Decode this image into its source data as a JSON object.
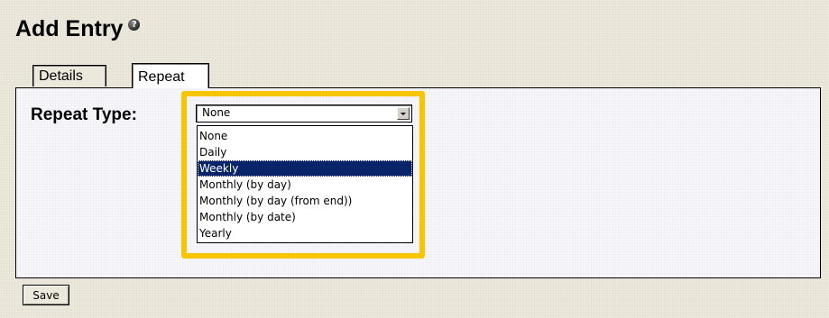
{
  "page": {
    "title": "Add Entry",
    "help_icon": "help-icon",
    "help_icon_glyph": "?"
  },
  "tabs": [
    {
      "label": "Details",
      "active": false
    },
    {
      "label": "Repeat",
      "active": true
    }
  ],
  "repeat": {
    "label": "Repeat Type:",
    "selected_value": "None",
    "options": [
      "None",
      "Daily",
      "Weekly",
      "Monthly (by day)",
      "Monthly (by day (from end))",
      "Monthly (by date)",
      "Yearly"
    ],
    "highlighted_option": "Weekly"
  },
  "actions": {
    "save_label": "Save"
  },
  "colors": {
    "highlight_frame": "#f8c500",
    "selection": "#0a246a",
    "page_background": "#ece9dc",
    "panel_background": "#f7f7fb"
  }
}
